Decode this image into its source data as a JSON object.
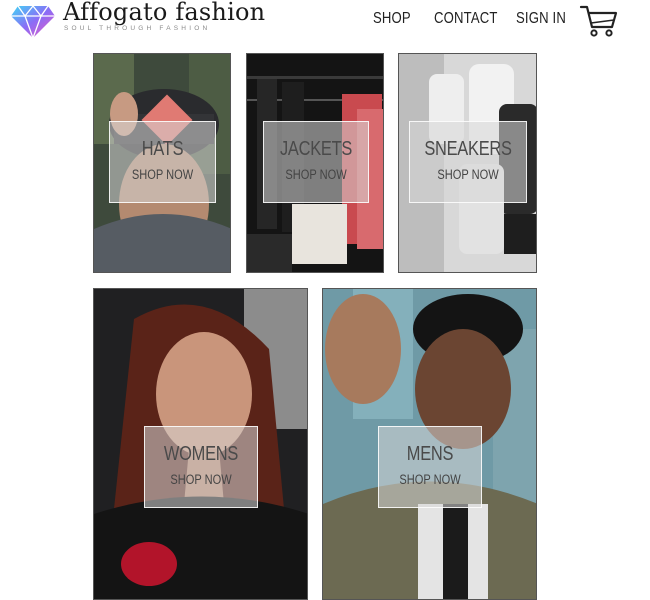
{
  "brand": {
    "title": "Affogato fashion",
    "tagline": "SOUL THROUGH FASHION",
    "logo_icon": "diamond-icon"
  },
  "nav": {
    "items": [
      {
        "label": "SHOP"
      },
      {
        "label": "CONTACT"
      },
      {
        "label": "SIGN IN"
      }
    ],
    "cart_icon": "cart-icon"
  },
  "categories": [
    {
      "label": "HATS",
      "cta": "SHOP NOW"
    },
    {
      "label": "JACKETS",
      "cta": "SHOP NOW"
    },
    {
      "label": "SNEAKERS",
      "cta": "SHOP NOW"
    },
    {
      "label": "WOMENS",
      "cta": "SHOP NOW"
    },
    {
      "label": "MENS",
      "cta": "SHOP NOW"
    }
  ]
}
